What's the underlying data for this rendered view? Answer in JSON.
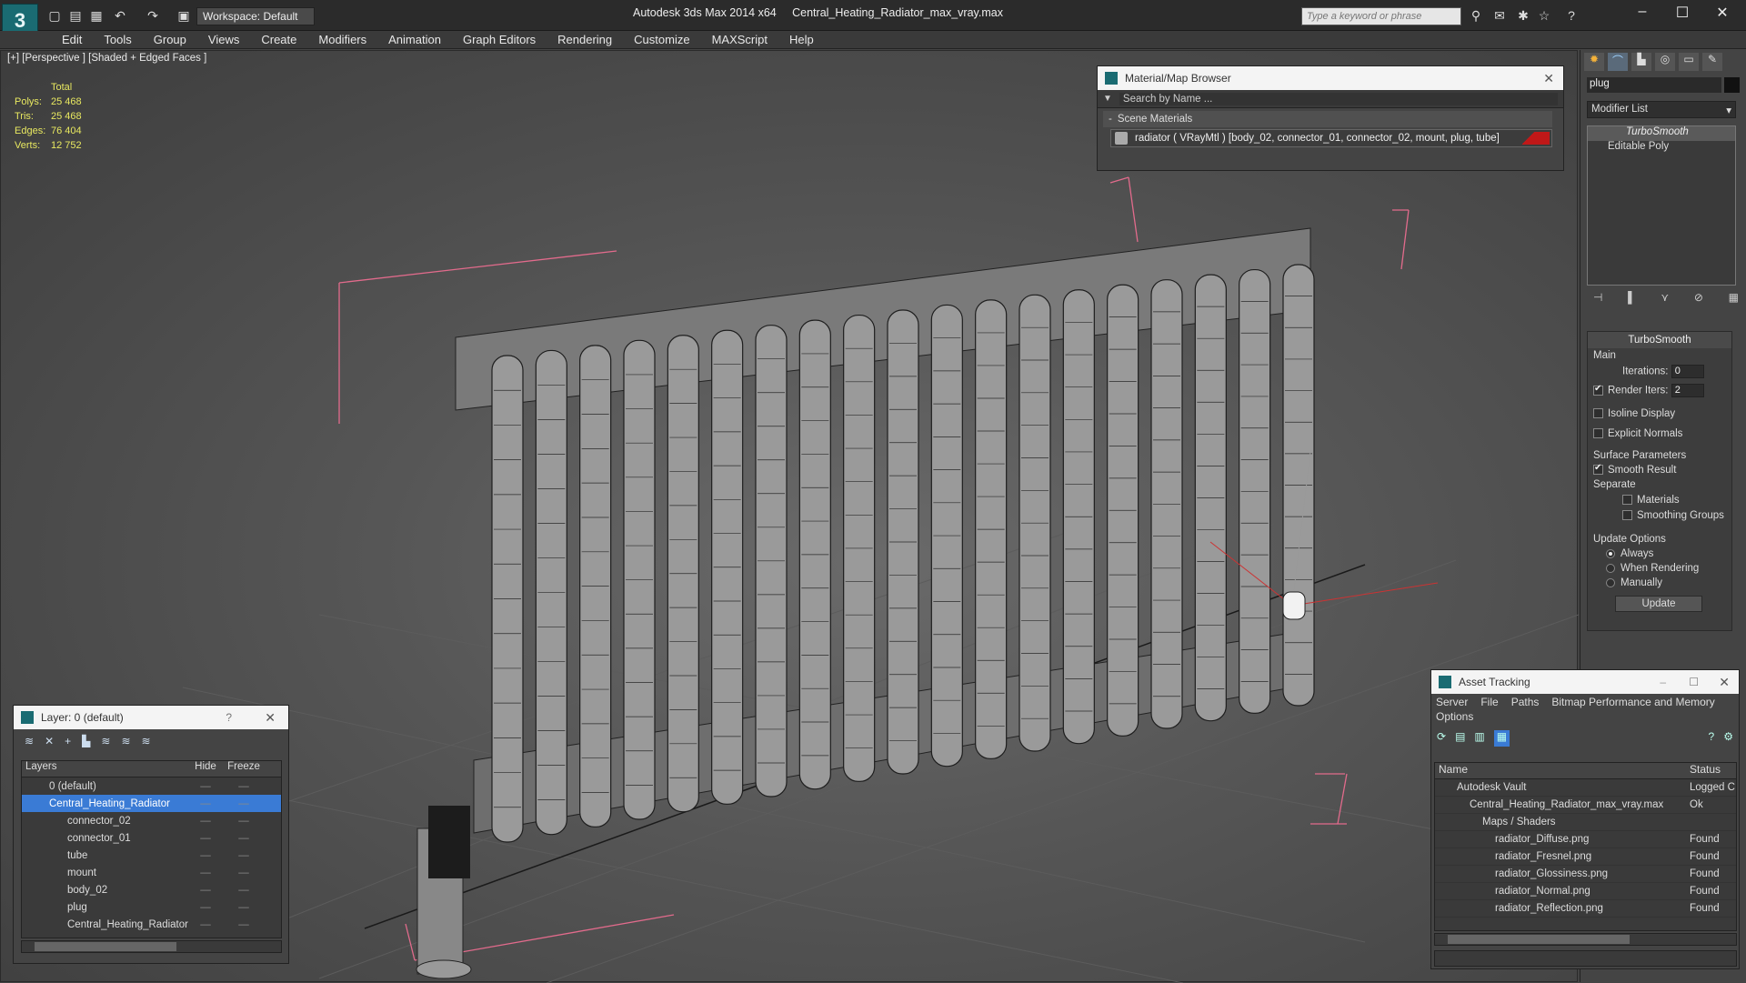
{
  "app": {
    "title": "Autodesk 3ds Max  2014 x64",
    "file": "Central_Heating_Radiator_max_vray.max",
    "workspace": "Workspace: Default",
    "search_placeholder": "Type a keyword or phrase"
  },
  "menu": [
    "Edit",
    "Tools",
    "Group",
    "Views",
    "Create",
    "Modifiers",
    "Animation",
    "Graph Editors",
    "Rendering",
    "Customize",
    "MAXScript",
    "Help"
  ],
  "viewport": {
    "label": "[+] [Perspective ] [Shaded + Edged Faces ]",
    "stats": {
      "header": "Total",
      "rows": [
        {
          "k": "Polys:",
          "v": "25 468"
        },
        {
          "k": "Tris:",
          "v": "25 468"
        },
        {
          "k": "Edges:",
          "v": "76 404"
        },
        {
          "k": "Verts:",
          "v": "12 752"
        }
      ]
    }
  },
  "material_browser": {
    "title": "Material/Map Browser",
    "search_placeholder": "Search by Name ...",
    "section": "Scene Materials",
    "item": "radiator  ( VRayMtl )  [body_02, connector_01, connector_02, mount, plug, tube]"
  },
  "command_panel": {
    "object_name": "plug",
    "modifier_list": "Modifier List",
    "stack": [
      "TurboSmooth",
      "Editable Poly"
    ],
    "rollout_title": "TurboSmooth",
    "main_label": "Main",
    "iterations_label": "Iterations:",
    "iterations_value": "0",
    "render_iters_label": "Render Iters:",
    "render_iters_value": "2",
    "isoline": "Isoline Display",
    "explicit": "Explicit Normals",
    "surface_params": "Surface Parameters",
    "smooth_result": "Smooth Result",
    "separate": "Separate",
    "materials": "Materials",
    "smoothing_groups": "Smoothing Groups",
    "update_options": "Update Options",
    "always": "Always",
    "when_rendering": "When Rendering",
    "manually": "Manually",
    "update_button": "Update"
  },
  "layer_panel": {
    "title": "Layer: 0 (default)",
    "help": "?",
    "col_layers": "Layers",
    "col_hide": "Hide",
    "col_freeze": "Freeze",
    "rows": [
      {
        "name": "0 (default)",
        "indent": 1,
        "selected": false
      },
      {
        "name": "Central_Heating_Radiator",
        "indent": 1,
        "selected": true
      },
      {
        "name": "connector_02",
        "indent": 2,
        "selected": false
      },
      {
        "name": "connector_01",
        "indent": 2,
        "selected": false
      },
      {
        "name": "tube",
        "indent": 2,
        "selected": false
      },
      {
        "name": "mount",
        "indent": 2,
        "selected": false
      },
      {
        "name": "body_02",
        "indent": 2,
        "selected": false
      },
      {
        "name": "plug",
        "indent": 2,
        "selected": false
      },
      {
        "name": "Central_Heating_Radiator",
        "indent": 2,
        "selected": false
      }
    ]
  },
  "asset_tracking": {
    "title": "Asset Tracking",
    "menu": [
      "Server",
      "File",
      "Paths",
      "Bitmap Performance and Memory"
    ],
    "menu2": "Options",
    "col_name": "Name",
    "col_status": "Status",
    "rows": [
      {
        "name": "Autodesk Vault",
        "status": "Logged C",
        "indent": 1
      },
      {
        "name": "Central_Heating_Radiator_max_vray.max",
        "status": "Ok",
        "indent": 2
      },
      {
        "name": "Maps / Shaders",
        "status": "",
        "indent": 3
      },
      {
        "name": "radiator_Diffuse.png",
        "status": "Found",
        "indent": 4
      },
      {
        "name": "radiator_Fresnel.png",
        "status": "Found",
        "indent": 4
      },
      {
        "name": "radiator_Glossiness.png",
        "status": "Found",
        "indent": 4
      },
      {
        "name": "radiator_Normal.png",
        "status": "Found",
        "indent": 4
      },
      {
        "name": "radiator_Reflection.png",
        "status": "Found",
        "indent": 4
      }
    ]
  },
  "colors": {
    "accent": "#1a6b72",
    "selection": "#3a7bd5",
    "stats": "#e8e860",
    "material_swatch": "#c01818"
  }
}
